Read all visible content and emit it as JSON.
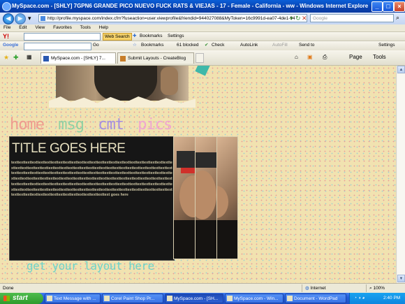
{
  "window": {
    "title": "MySpace.com - [SHLY] 7GPN6 GRANDE PICO NUEVO FUCK RATS & VIEJAS - 17 - Female - California - ww - Windows Internet Explorer pro"
  },
  "address_bar": {
    "url": "http://profile.myspace.com/index.cfm?fuseaction=user.viewprofile&friendid=944027088&MyToken=16c9991d-ea07-4de1-94",
    "search_placeholder": "Google"
  },
  "menu": [
    "File",
    "Edit",
    "View",
    "Favorites",
    "Tools",
    "Help"
  ],
  "yahoo_toolbar": {
    "web_search": "Web Search",
    "bookmarks": "Bookmarks",
    "settings": "Settings"
  },
  "google_toolbar": {
    "brand": "Google",
    "go": "Go",
    "bookmarks": "Bookmarks",
    "blocked": "61 blocked",
    "check": "Check",
    "autolink": "AutoLink",
    "autofill": "AutoFill",
    "send_to": "Send to",
    "settings": "Settings"
  },
  "tabs": [
    {
      "label": "MySpace.com - [SHLY] 7...",
      "active": true
    },
    {
      "label": "Submit Layouts - CreateBlog",
      "active": false
    }
  ],
  "command_bar": {
    "page": "Page",
    "tools": "Tools"
  },
  "page": {
    "nav": {
      "home": "home",
      "msg": "msg",
      "cmt": "cmt",
      "pics": "pics"
    },
    "box_title": "TITLE GOES HERE",
    "box_text": "texttexttexttexttexttexttexttexttexttexttexttexttexttexttexttexttexttexttexttexttexttexttexttexttexttexttexttexttexttexttexttexttexttexttexttexttexttexttexttexttexttexttexttexttexttexttexttexttexttexttexttexttexttexttexttexttexttexttexttexttexttexttexttexttexttexttexttexttexttexttexttexttexttexttexttexttexttexttexttexttexttexttexttexttexttexttexttexttexttexttexttexttexttexttexttexttexttexttexttexttexttexttexttexttexttexttexttexttexttexttexttexttexttexttexttexttexttexttexttexttexttexttexttexttexttexttexttexttexttexttexttexttexttexttexttexttexttexttexttexttexttexttexttexttexttexttexttexttexttexttexttexttexttexttexttexttexttexttexttexttexttext goes here",
    "footer": "get your layout here"
  },
  "status_bar": {
    "status": "Done",
    "zone": "Internet",
    "zoom": "100%"
  },
  "taskbar": {
    "start": "start",
    "tasks": [
      {
        "label": "Text Message with ...",
        "active": false
      },
      {
        "label": "Corel Paint Shop Pr...",
        "active": false
      },
      {
        "label": "MySpace.com - [SH...",
        "active": true
      },
      {
        "label": "MySpace.com - Win...",
        "active": false
      },
      {
        "label": "Document - WordPad",
        "active": false
      }
    ],
    "clock": "2:40 PM"
  },
  "colors": {
    "page_bg": "#f1e2b0",
    "nav_home": "#ef9b8e",
    "nav_msg": "#8fd0a3",
    "nav_cmt": "#a58fe0",
    "nav_pics": "#f0a6d0",
    "footer": "#6ed3c9",
    "box_bg": "#161616"
  }
}
